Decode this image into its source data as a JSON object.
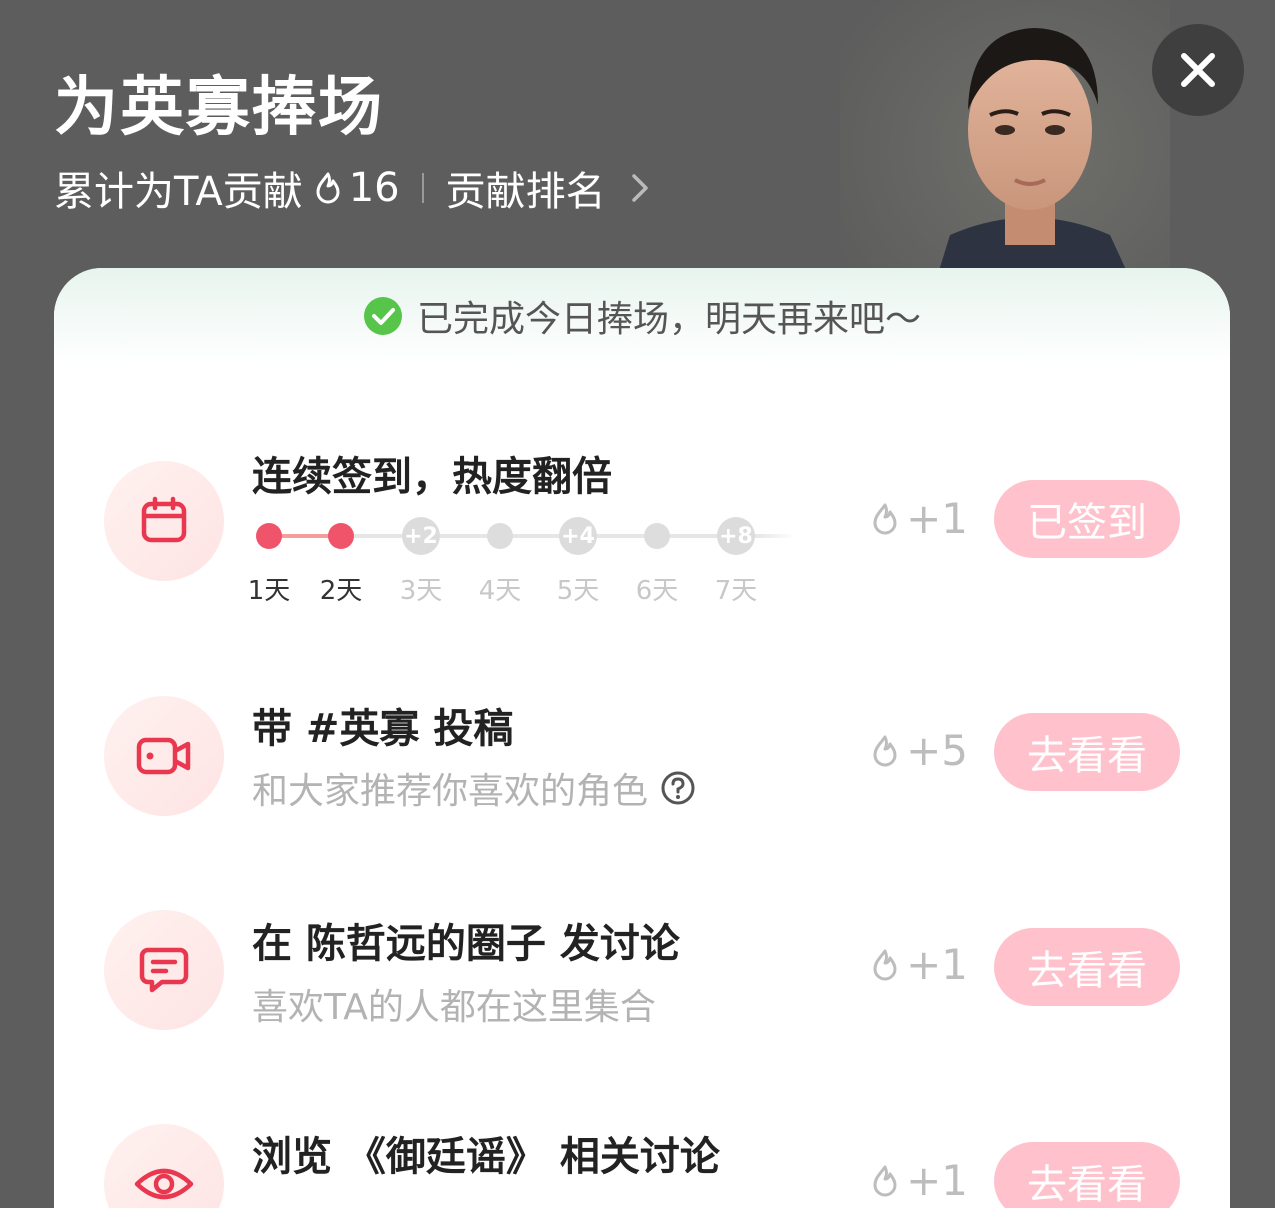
{
  "header": {
    "title": "为英寡捧场",
    "contribution_label": "累计为TA贡献",
    "contribution_value": "16",
    "rank_label": "贡献排名"
  },
  "banner": {
    "text": "已完成今日捧场，明天再来吧～"
  },
  "tasks": [
    {
      "title": "连续签到，热度翻倍",
      "reward": "+1",
      "button": "已签到",
      "icon": "calendar-icon",
      "streak": {
        "days": [
          "1天",
          "2天",
          "3天",
          "4天",
          "5天",
          "6天",
          "7天"
        ],
        "bonuses": [
          "+2",
          "+4",
          "+8"
        ],
        "completed_days": 2
      }
    },
    {
      "title": "带 #英寡 投稿",
      "desc": "和大家推荐你喜欢的角色",
      "reward": "+5",
      "button": "去看看",
      "icon": "video-camera-icon"
    },
    {
      "title": "在 陈哲远的圈子 发讨论",
      "desc": "喜欢TA的人都在这里集合",
      "reward": "+1",
      "button": "去看看",
      "icon": "chat-bubble-icon"
    },
    {
      "title": "浏览 《御廷谣》 相关讨论",
      "reward": "+1",
      "button": "去看看",
      "icon": "eye-icon"
    }
  ],
  "colors": {
    "accent": "#f0546b",
    "button_bg": "#ffc2cc",
    "overlay": "#5d5d5d"
  }
}
